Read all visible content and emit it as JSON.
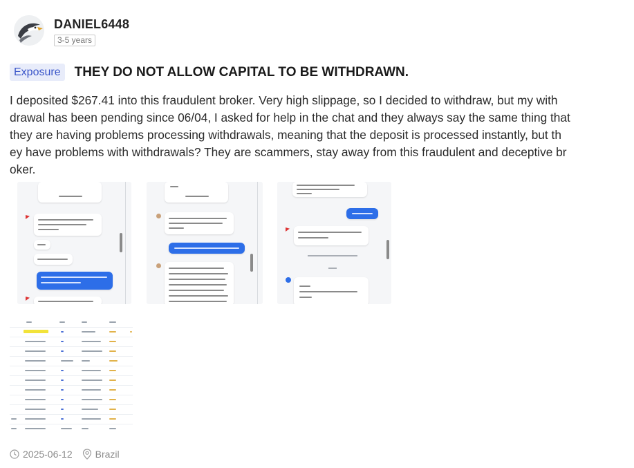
{
  "user": {
    "name": "DANIEL6448",
    "experience": "3-5 years"
  },
  "post": {
    "tag": "Exposure",
    "title": "THEY DO NOT ALLOW CAPITAL TO BE WITHDRAWN.",
    "body": "I deposited $267.41 into this fraudulent broker. Very high slippage, so I decided to withdraw, but my with\ndrawal has been pending since 06/04, I asked for help in the chat and they always say the same thing that\nthey are having problems processing withdrawals, meaning that the deposit is processed instantly, but th\ney have problems with withdrawals? They are scammers, stay away from this fraudulent and deceptive br\noker.",
    "date": "2025-06-12",
    "location": "Brazil"
  },
  "attachments": {
    "count": 4
  },
  "colors": {
    "tag_bg": "#e8ecfa",
    "tag_text": "#3b56c9",
    "chat_blue": "#2d6ee8",
    "muted": "#8a8a8a"
  },
  "icons": {
    "date": "clock-icon",
    "location": "location-pin-icon"
  }
}
